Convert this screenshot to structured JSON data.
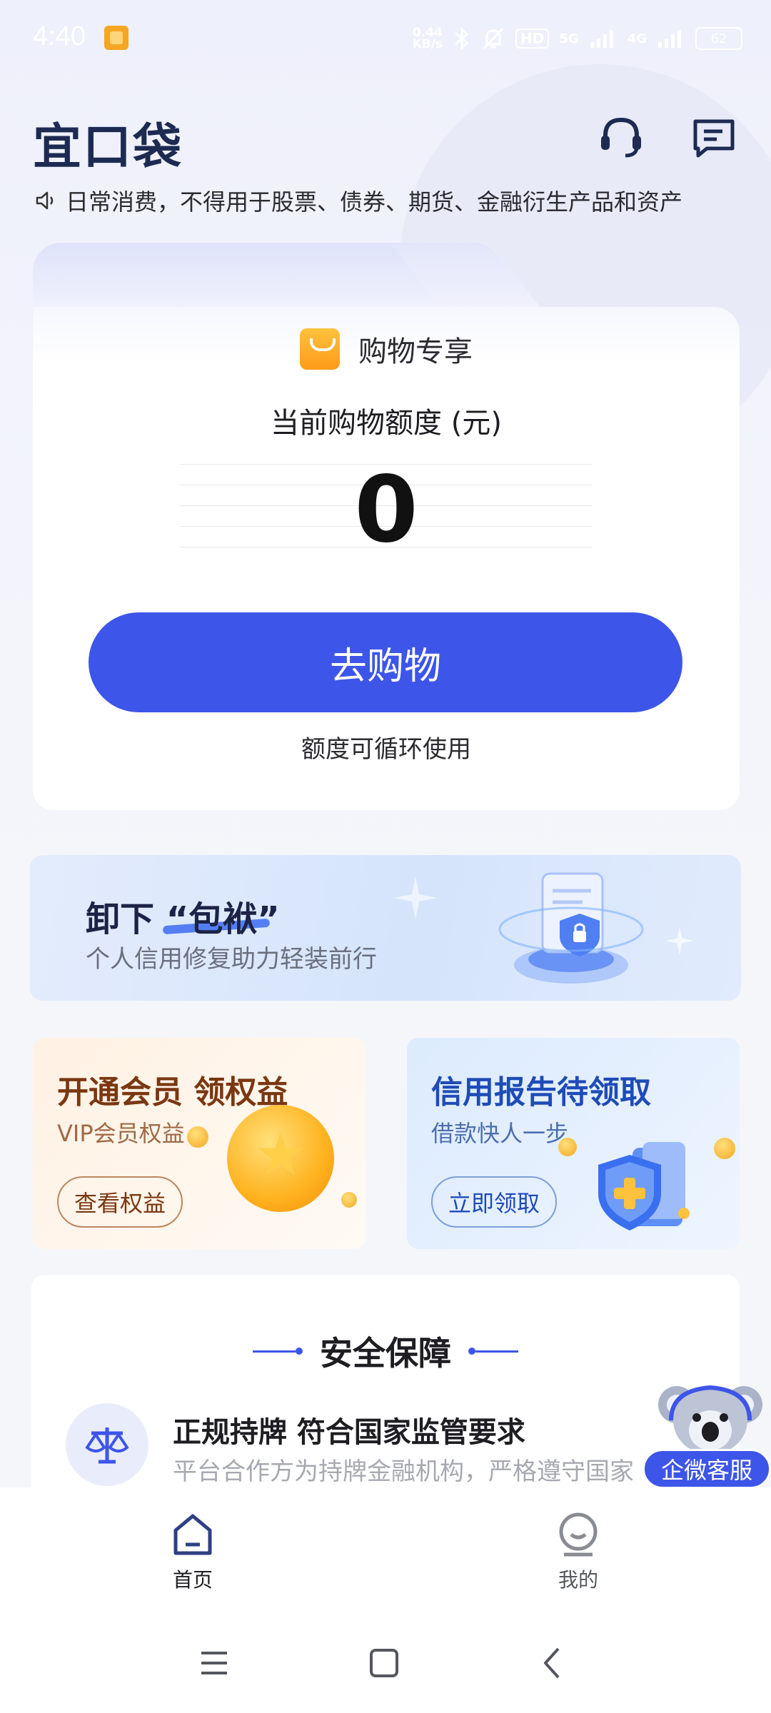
{
  "status_bar": {
    "time": "4:40",
    "speed_value": "0.44",
    "speed_unit": "KB/s",
    "hd_label": "HD",
    "net1": "5G",
    "net2": "4G",
    "battery": "62"
  },
  "header": {
    "logo": "宜口袋",
    "notice": "日常消费，不得用于股票、债券、期货、金融衍生产品和资产"
  },
  "main_card": {
    "title": "购物专享",
    "credit_label": "当前购物额度 (元)",
    "credit_value": "0",
    "button_label": "去购物",
    "note": "额度可循环使用"
  },
  "banner": {
    "title_prefix": "卸下",
    "title_quoted": "“包袱”",
    "subtitle": "个人信用修复助力轻装前行"
  },
  "vip_card": {
    "title": "开通会员 领权益",
    "subtitle": "VIP会员权益",
    "button_label": "查看权益"
  },
  "report_card": {
    "title": "信用报告待领取",
    "subtitle": "借款快人一步",
    "button_label": "立即领取"
  },
  "security": {
    "title": "安全保障",
    "item_title": "正规持牌 符合国家监管要求",
    "item_desc": "平台合作方为持牌金融机构，严格遵守国家"
  },
  "floating_service": {
    "label": "企微客服"
  },
  "bottom_nav": {
    "items": [
      {
        "label": "首页",
        "active": true
      },
      {
        "label": "我的",
        "active": false
      }
    ]
  },
  "colors": {
    "primary": "#3d55e8",
    "logo": "#1d2b52",
    "vip_text": "#7a3711",
    "report_text": "#1e4bb8"
  }
}
